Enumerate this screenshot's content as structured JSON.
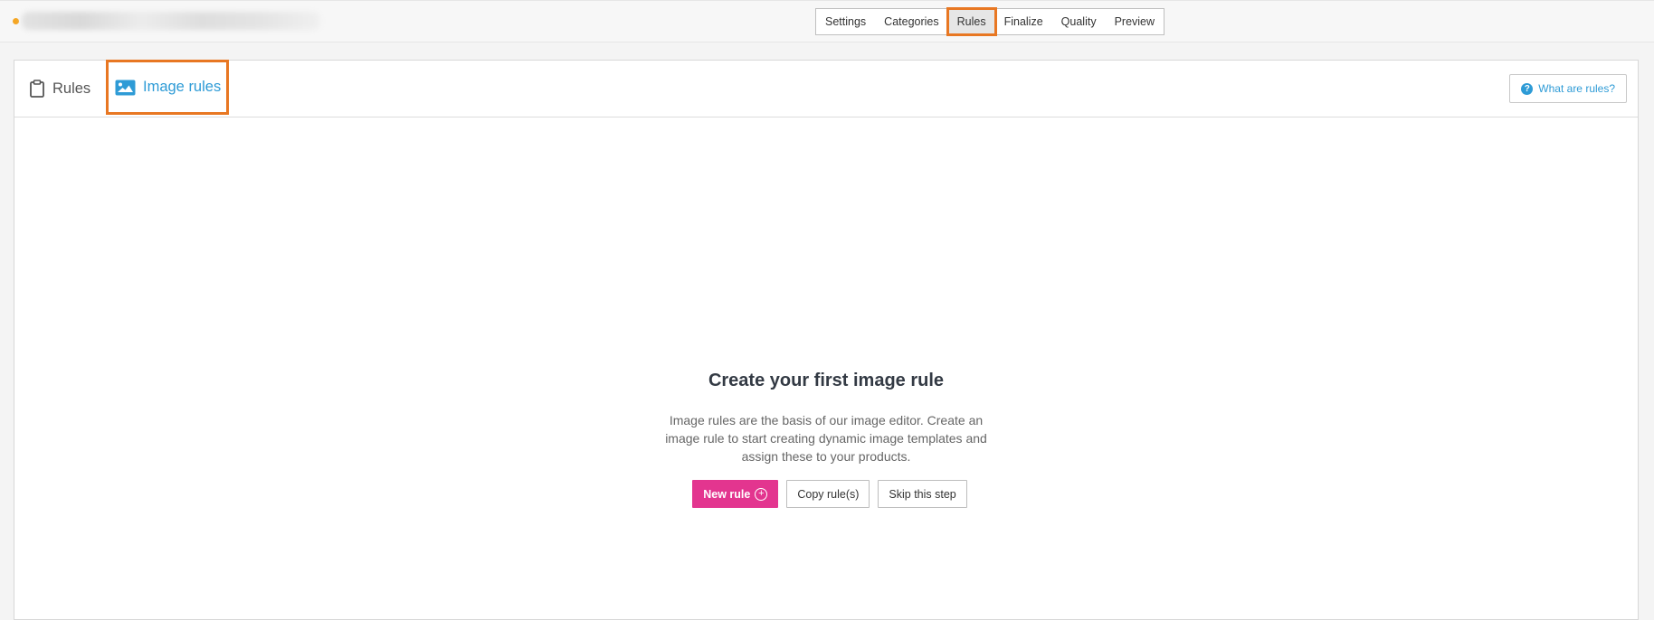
{
  "header": {
    "steps": [
      {
        "label": "Settings",
        "active": false
      },
      {
        "label": "Categories",
        "active": false
      },
      {
        "label": "Rules",
        "active": true
      },
      {
        "label": "Finalize",
        "active": false
      },
      {
        "label": "Quality",
        "active": false
      },
      {
        "label": "Preview",
        "active": false
      }
    ],
    "status_dot_color": "#f5a623"
  },
  "tabs": {
    "rules": {
      "label": "Rules",
      "icon": "clipboard-icon"
    },
    "image_rules": {
      "label": "Image rules",
      "icon": "image-icon",
      "active": true
    }
  },
  "help": {
    "label": "What are rules?",
    "icon": "question-circle-icon"
  },
  "empty_state": {
    "title": "Create your first image rule",
    "description": "Image rules are the basis of our image editor. Create an image rule to start creating dynamic image templates and assign these to your products.",
    "buttons": {
      "new_rule": "New rule",
      "copy_rules": "Copy rule(s)",
      "skip": "Skip this step"
    }
  },
  "colors": {
    "accent_blue": "#2e9bd6",
    "primary_pink": "#e3358f",
    "highlight_orange": "#e87722"
  }
}
